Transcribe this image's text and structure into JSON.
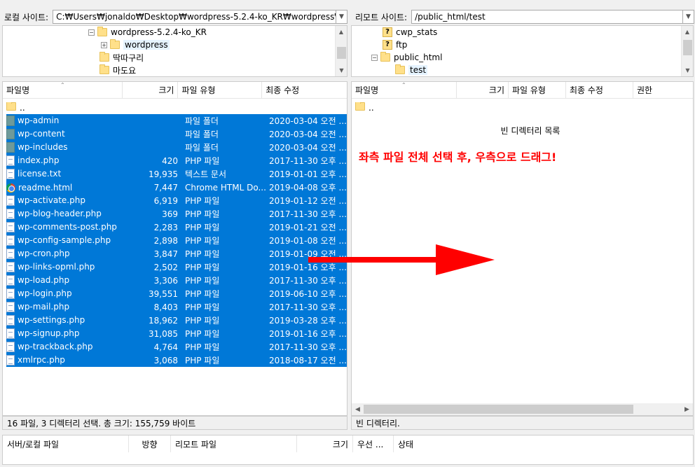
{
  "local": {
    "site_label": "로컬 사이트:",
    "path": "C:₩Users₩jonaldo₩Desktop₩wordpress-5.2.4-ko_KR₩wordpress₩",
    "tree": [
      "wordpress-5.2.4-ko_KR",
      "wordpress",
      "딱따구리",
      "마도요"
    ],
    "columns": [
      "파일명",
      "크기",
      "파일 유형",
      "최종 수정"
    ],
    "parent": "..",
    "files": [
      {
        "name": "wp-admin",
        "size": "",
        "type": "파일 폴더",
        "modified": "2020-03-04 오전 ...",
        "icon": "dir"
      },
      {
        "name": "wp-content",
        "size": "",
        "type": "파일 폴더",
        "modified": "2020-03-04 오전 ...",
        "icon": "dir"
      },
      {
        "name": "wp-includes",
        "size": "",
        "type": "파일 폴더",
        "modified": "2020-03-04 오전 ...",
        "icon": "dir"
      },
      {
        "name": "index.php",
        "size": "420",
        "type": "PHP 파일",
        "modified": "2017-11-30 오후 ...",
        "icon": "file"
      },
      {
        "name": "license.txt",
        "size": "19,935",
        "type": "텍스트 문서",
        "modified": "2019-01-01 오후 ...",
        "icon": "file"
      },
      {
        "name": "readme.html",
        "size": "7,447",
        "type": "Chrome HTML Do...",
        "modified": "2019-04-08 오후 ...",
        "icon": "chrome"
      },
      {
        "name": "wp-activate.php",
        "size": "6,919",
        "type": "PHP 파일",
        "modified": "2019-01-12 오전 ...",
        "icon": "file"
      },
      {
        "name": "wp-blog-header.php",
        "size": "369",
        "type": "PHP 파일",
        "modified": "2017-11-30 오후 ...",
        "icon": "file"
      },
      {
        "name": "wp-comments-post.php",
        "size": "2,283",
        "type": "PHP 파일",
        "modified": "2019-01-21 오전 ...",
        "icon": "file"
      },
      {
        "name": "wp-config-sample.php",
        "size": "2,898",
        "type": "PHP 파일",
        "modified": "2019-01-08 오전 ...",
        "icon": "file"
      },
      {
        "name": "wp-cron.php",
        "size": "3,847",
        "type": "PHP 파일",
        "modified": "2019-01-09 오전 ...",
        "icon": "file"
      },
      {
        "name": "wp-links-opml.php",
        "size": "2,502",
        "type": "PHP 파일",
        "modified": "2019-01-16 오후 ...",
        "icon": "file"
      },
      {
        "name": "wp-load.php",
        "size": "3,306",
        "type": "PHP 파일",
        "modified": "2017-11-30 오후 ...",
        "icon": "file"
      },
      {
        "name": "wp-login.php",
        "size": "39,551",
        "type": "PHP 파일",
        "modified": "2019-06-10 오후 ...",
        "icon": "file"
      },
      {
        "name": "wp-mail.php",
        "size": "8,403",
        "type": "PHP 파일",
        "modified": "2017-11-30 오후 ...",
        "icon": "file"
      },
      {
        "name": "wp-settings.php",
        "size": "18,962",
        "type": "PHP 파일",
        "modified": "2019-03-28 오후 ...",
        "icon": "file"
      },
      {
        "name": "wp-signup.php",
        "size": "31,085",
        "type": "PHP 파일",
        "modified": "2019-01-16 오후 ...",
        "icon": "file"
      },
      {
        "name": "wp-trackback.php",
        "size": "4,764",
        "type": "PHP 파일",
        "modified": "2017-11-30 오후 ...",
        "icon": "file"
      },
      {
        "name": "xmlrpc.php",
        "size": "3,068",
        "type": "PHP 파일",
        "modified": "2018-08-17 오전 ...",
        "icon": "file"
      }
    ],
    "status": "16 파일, 3 디렉터리 선택. 총 크기: 155,759 바이트"
  },
  "remote": {
    "site_label": "리모트 사이트:",
    "path": "/public_html/test",
    "tree": [
      "cwp_stats",
      "ftp",
      "public_html",
      "test"
    ],
    "columns": [
      "파일명",
      "크기",
      "파일 유형",
      "최종 수정",
      "권한"
    ],
    "parent": "..",
    "empty_message": "빈 디렉터리 목록",
    "status": "빈 디렉터리."
  },
  "annotation": {
    "text": "좌측 파일 전체 선택 후, 우측으로 드래그!",
    "color": "#ff0000"
  },
  "queue": {
    "columns": [
      "서버/로컬 파일",
      "방향",
      "리모트 파일",
      "크기",
      "우선 ...",
      "상태"
    ]
  },
  "colors": {
    "selection": "#0078d7"
  }
}
